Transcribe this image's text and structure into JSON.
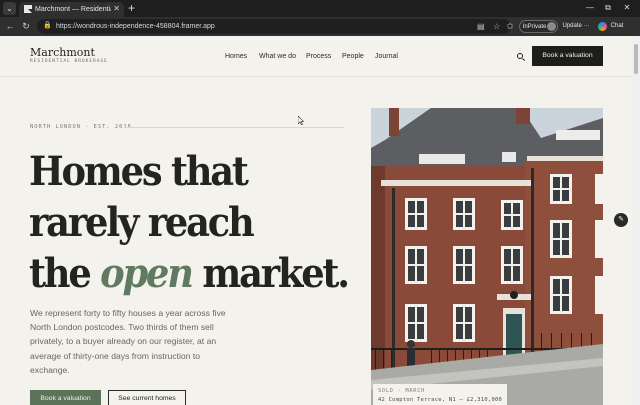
{
  "browser": {
    "tab_title": "Marchmont — Residential broker…",
    "tab_close": "✕",
    "new_tab": "+",
    "url": "https://wondrous-independence-458804.framer.app",
    "inprivate_label": "InPrivate",
    "update_label": "Update",
    "chat_label": "Chat",
    "window_min": "—",
    "window_max": "⧉",
    "window_close": "✕"
  },
  "site": {
    "logo": "Marchmont",
    "logo_sub": "RESIDENTIAL BROKERAGE",
    "nav": [
      "Homes",
      "What we do",
      "Process",
      "People",
      "Journal"
    ],
    "cta_top": "Book a valuation"
  },
  "hero": {
    "eyebrow": "NORTH LONDON · EST. 2016",
    "headline_line1": "Homes that",
    "headline_line2": "rarely reach",
    "headline_line3_pre": "the ",
    "headline_line3_em": "open",
    "headline_line3_post": " market.",
    "lede": "We represent forty to fifty houses a year across five North London postcodes. Two thirds of them sell privately, to a buyer already on our register, at an average of thirty-one days from instruction to exchange.",
    "cta_primary": "Book a valuation",
    "cta_secondary": "See current homes"
  },
  "photo_caption": {
    "status": "SOLD · MARCH",
    "detail": "42 Compton Terrace, N1 — £2,310,000"
  },
  "colors": {
    "page_bg": "#f4f2ec",
    "ink": "#23231f",
    "accent_green": "#5b7358",
    "brick": "#8a4a39"
  },
  "icons": {
    "search": "search-icon",
    "edit": "pencil-icon"
  }
}
